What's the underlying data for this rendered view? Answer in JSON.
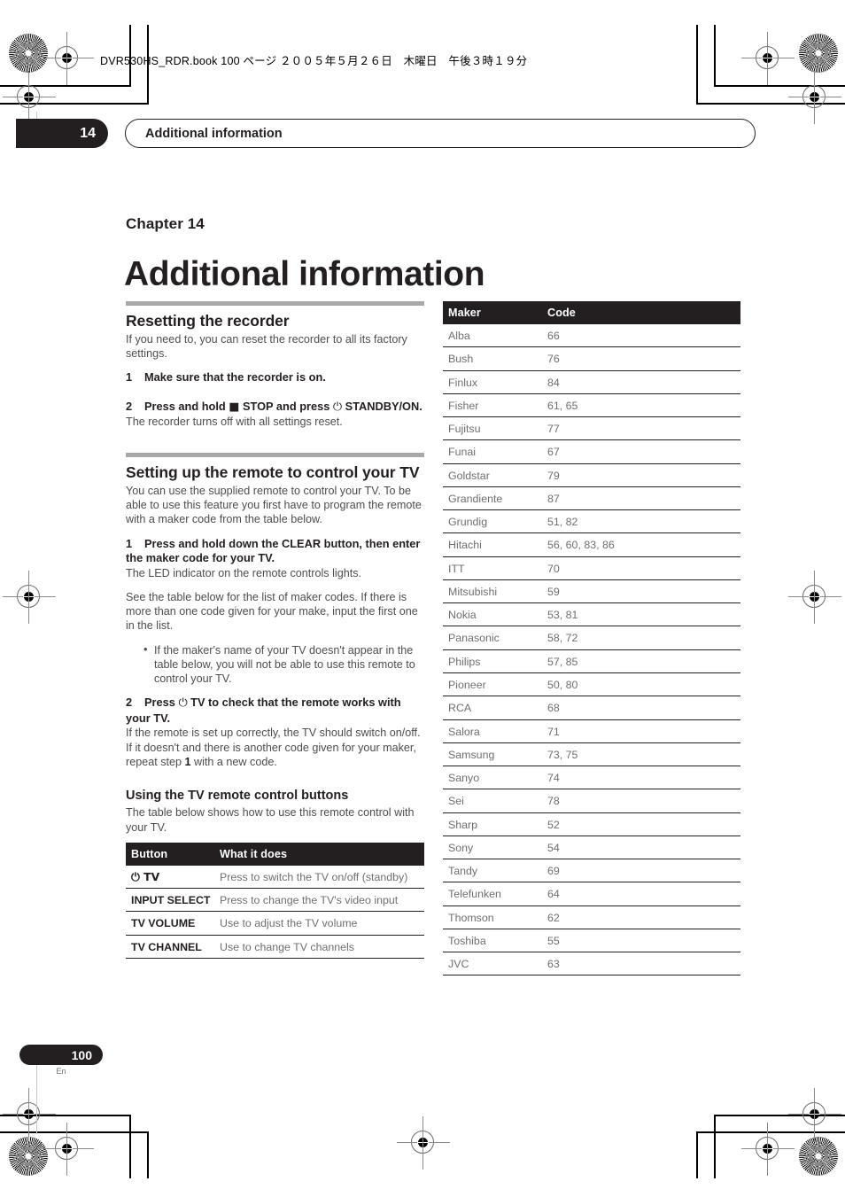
{
  "print_marks": {
    "book_line": "DVR530HS_RDR.book  100 ページ  ２００５年５月２６日　木曜日　午後３時１９分"
  },
  "running_header": {
    "chapter_number": "14",
    "title": "Additional information"
  },
  "chapter": {
    "label": "Chapter 14",
    "title": "Additional information"
  },
  "left_column": {
    "section1": {
      "heading": "Resetting the recorder",
      "intro": "If you need to, you can reset the recorder to all its factory settings.",
      "steps": [
        {
          "num": "1",
          "text": "Make sure that the recorder is on.",
          "note": ""
        },
        {
          "num": "2",
          "text_before": "Press and hold",
          "symbol_stop": "■",
          "text_mid": "STOP and press",
          "symbol_power": "⏻",
          "text_after": "STANDBY/ON.",
          "note": "The recorder turns off with all settings reset."
        }
      ]
    },
    "section2": {
      "heading": "Setting up the remote to control your TV",
      "intro": "You can use the supplied remote to control your TV. To be able to use this feature you first have to program the remote with a maker code from the table below.",
      "step1": {
        "num": "1",
        "text": "Press and hold down the CLEAR button, then enter the maker code for your TV.",
        "note": "The LED indicator on the remote controls lights."
      },
      "para_after_step1": "See the table below for the list of maker codes. If there is more than one code given for your make, input the first one in the list.",
      "bullets": [
        "If the maker's name of your TV doesn't appear in the table below, you will not be able to use this remote to control your TV."
      ],
      "step2": {
        "num": "2",
        "text_before": "Press",
        "symbol_power": "⏻",
        "text_after": "TV to check that the remote works with your TV.",
        "note_part1": "If the remote is set up correctly, the TV should switch on/off. If it doesn't and there is another code given for your maker, repeat step ",
        "note_bold": "1",
        "note_part2": " with a new code."
      }
    },
    "section3": {
      "heading": "Using the TV remote control buttons",
      "intro": "The table below shows how to use this remote control with your TV.",
      "table": {
        "headers": [
          "Button",
          "What it does"
        ],
        "rows": [
          {
            "button": "⏻ TV",
            "does": "Press to switch the TV on/off (standby)"
          },
          {
            "button": "INPUT SELECT",
            "does": "Press to change the TV's video input"
          },
          {
            "button": "TV VOLUME",
            "does": "Use to adjust the TV volume"
          },
          {
            "button": "TV CHANNEL",
            "does": "Use to change TV channels"
          }
        ]
      }
    }
  },
  "right_column": {
    "table": {
      "headers": [
        "Maker",
        "Code"
      ],
      "rows": [
        {
          "maker": "Alba",
          "code": "66"
        },
        {
          "maker": "Bush",
          "code": "76"
        },
        {
          "maker": "Finlux",
          "code": "84"
        },
        {
          "maker": "Fisher",
          "code": "61, 65"
        },
        {
          "maker": "Fujitsu",
          "code": "77"
        },
        {
          "maker": "Funai",
          "code": "67"
        },
        {
          "maker": "Goldstar",
          "code": "79"
        },
        {
          "maker": "Grandiente",
          "code": "87"
        },
        {
          "maker": "Grundig",
          "code": "51, 82"
        },
        {
          "maker": "Hitachi",
          "code": "56, 60, 83, 86"
        },
        {
          "maker": "ITT",
          "code": "70"
        },
        {
          "maker": "Mitsubishi",
          "code": "59"
        },
        {
          "maker": "Nokia",
          "code": "53, 81"
        },
        {
          "maker": "Panasonic",
          "code": "58, 72"
        },
        {
          "maker": "Philips",
          "code": "57, 85"
        },
        {
          "maker": "Pioneer",
          "code": "50, 80"
        },
        {
          "maker": "RCA",
          "code": "68"
        },
        {
          "maker": "Salora",
          "code": "71"
        },
        {
          "maker": "Samsung",
          "code": "73, 75"
        },
        {
          "maker": "Sanyo",
          "code": "74"
        },
        {
          "maker": "Sei",
          "code": "78"
        },
        {
          "maker": "Sharp",
          "code": "52"
        },
        {
          "maker": "Sony",
          "code": "54"
        },
        {
          "maker": "Tandy",
          "code": "69"
        },
        {
          "maker": "Telefunken",
          "code": "64"
        },
        {
          "maker": "Thomson",
          "code": "62"
        },
        {
          "maker": "Toshiba",
          "code": "55"
        },
        {
          "maker": "JVC",
          "code": "63"
        }
      ]
    }
  },
  "footer": {
    "page_number": "100",
    "language": "En"
  },
  "colors": {
    "ink": "#231f20",
    "body_text": "#4d4d4d",
    "rule": "#a8a8a8"
  }
}
